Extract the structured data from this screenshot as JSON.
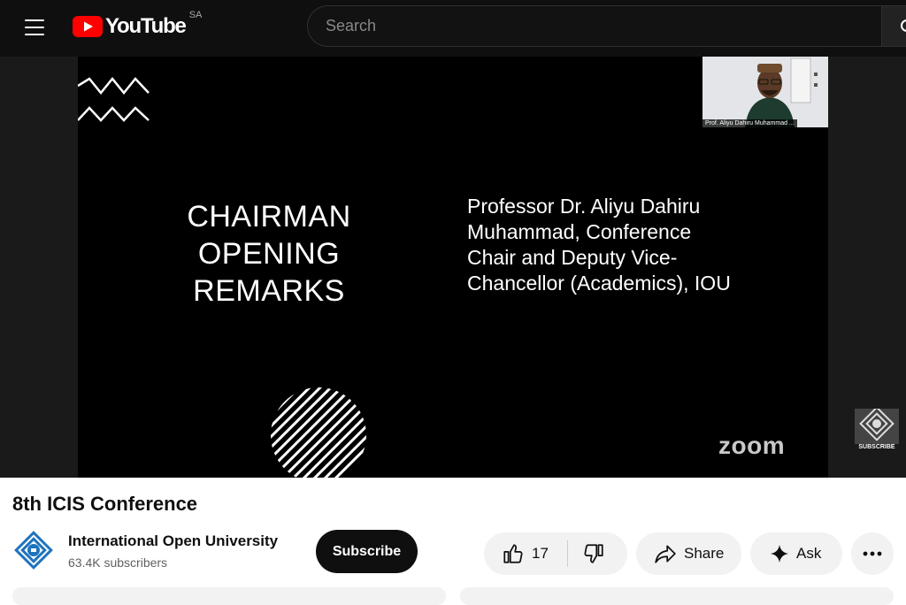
{
  "header": {
    "logo_text": "YouTube",
    "region": "SA",
    "search_placeholder": "Search",
    "icons": [
      "menu-icon",
      "youtube-logo-icon",
      "search-icon"
    ]
  },
  "slide": {
    "title": "CHAIRMAN\nOPENING\nREMARKS",
    "speaker": "Professor Dr. Aliyu Dahiru\nMuhammad, Conference\nChair and Deputy Vice-\nChancellor (Academics), IOU",
    "app_logo": "zoom",
    "participant_name": "Prof. Aliyu Dahiru Muhammad ...",
    "watermark_text": "SUBSCRIBE"
  },
  "video": {
    "title": "8th ICIS Conference"
  },
  "channel": {
    "name": "International Open University",
    "subscribers": "63.4K subscribers",
    "subscribe_label": "Subscribe"
  },
  "actions": {
    "likes": "17",
    "share_label": "Share",
    "ask_label": "Ask"
  },
  "colors": {
    "brand_red": "#ff0000",
    "header_bg": "#0f0f0f",
    "channel_blue": "#1e73be"
  }
}
